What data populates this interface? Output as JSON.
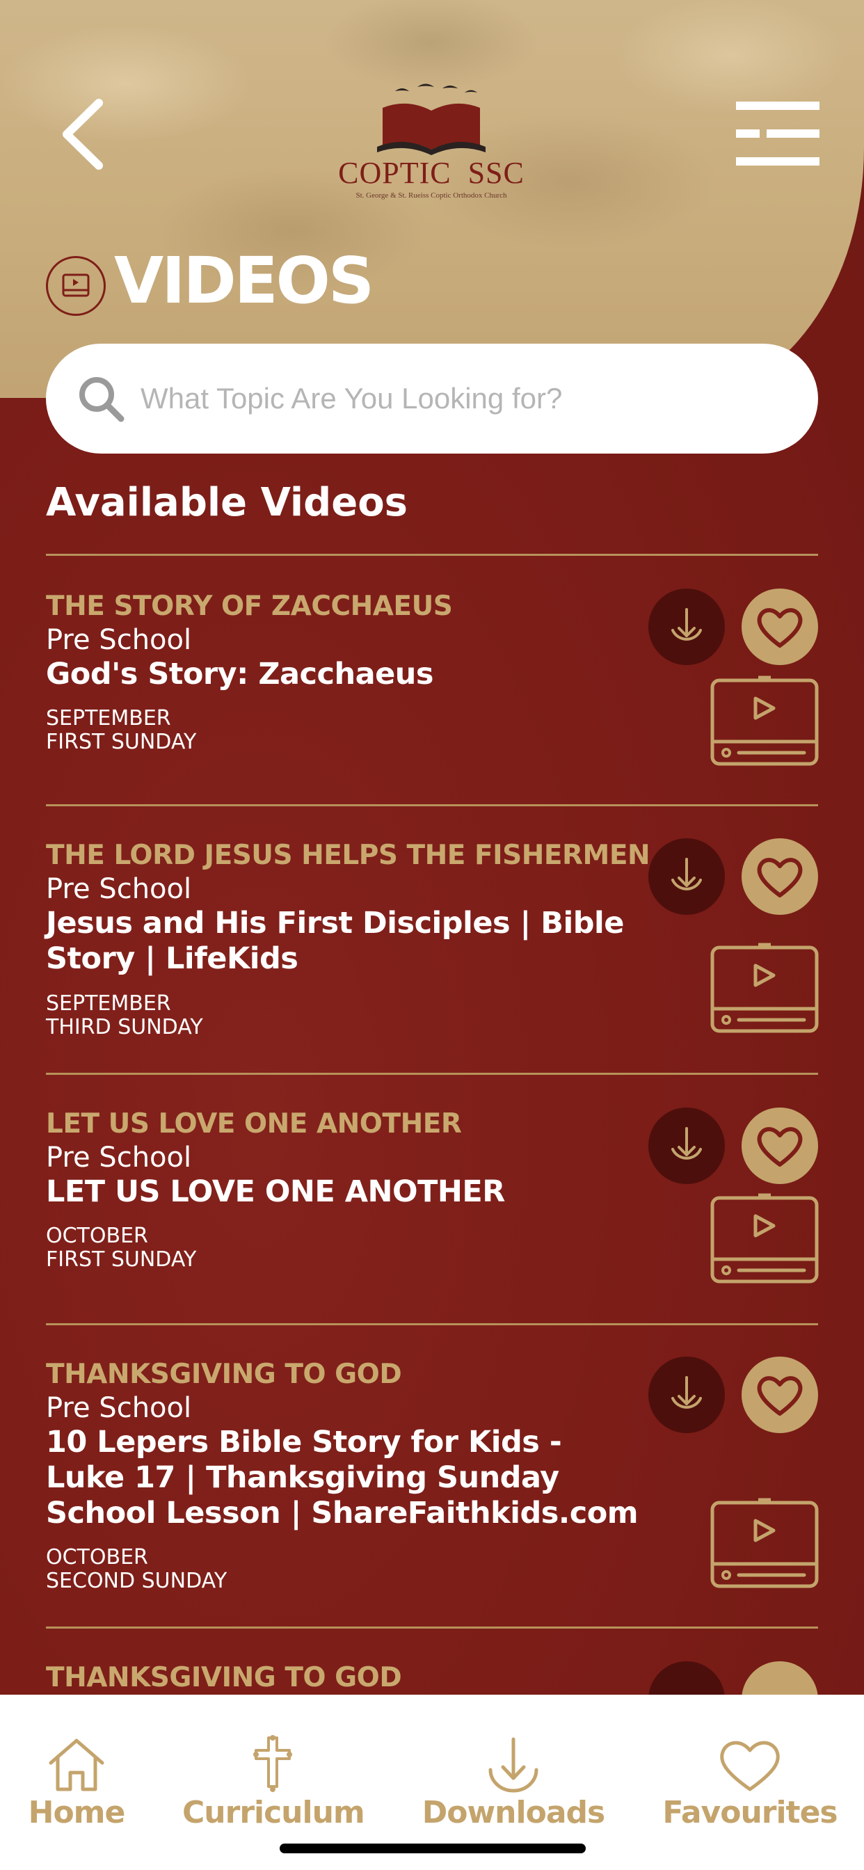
{
  "header": {
    "logo_title": "COPTIC  SSC",
    "logo_subtitle": "St. George & St. Rueiss Coptic Orthodox Church",
    "page_title": "VIDEOS"
  },
  "search": {
    "placeholder": "What Topic Are You Looking for?",
    "value": ""
  },
  "section_title": "Available Videos",
  "videos": [
    {
      "topic": "THE STORY OF ZACCHAEUS",
      "level": "Pre School",
      "title": "God's Story: Zacchaeus",
      "month": "SEPTEMBER",
      "sunday": "FIRST SUNDAY"
    },
    {
      "topic": "THE LORD JESUS HELPS THE FISHERMEN",
      "level": "Pre School",
      "title": "Jesus and His First Disciples | Bible Story | LifeKids",
      "month": "SEPTEMBER",
      "sunday": "THIRD SUNDAY"
    },
    {
      "topic": "LET US LOVE ONE ANOTHER",
      "level": "Pre School",
      "title": "LET US LOVE ONE ANOTHER",
      "month": "OCTOBER",
      "sunday": "FIRST SUNDAY"
    },
    {
      "topic": "THANKSGIVING TO GOD",
      "level": "Pre School",
      "title": "10 Lepers Bible Story for Kids - Luke 17 | Thanksgiving Sunday School Lesson | ShareFaithkids.com",
      "month": "OCTOBER",
      "sunday": "SECOND SUNDAY"
    },
    {
      "topic": "THANKSGIVING TO GOD"
    }
  ],
  "bottom_nav": {
    "home": "Home",
    "curriculum": "Curriculum",
    "downloads": "Downloads",
    "favourites": "Favourites"
  },
  "colors": {
    "background": "#7a1c17",
    "accent_gold": "#c4a46c",
    "download_circle": "#4d0f0c",
    "header_beige": "#c8ac7c"
  },
  "icons": [
    "back-chevron-icon",
    "menu-icon",
    "book-logo-icon",
    "video-icon",
    "search-icon",
    "download-icon",
    "heart-icon",
    "play-video-icon",
    "home-icon",
    "cross-icon"
  ]
}
